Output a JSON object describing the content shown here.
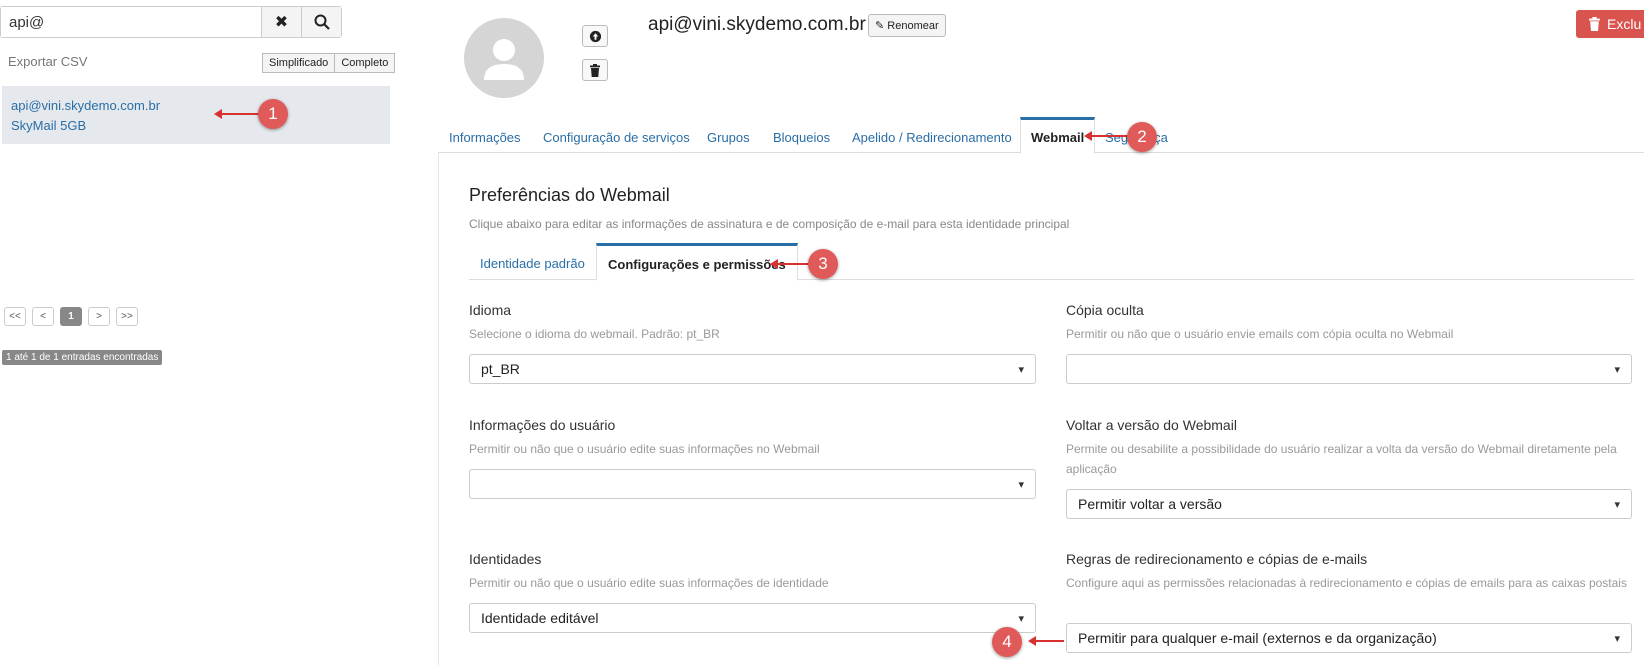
{
  "search": {
    "value": "api@"
  },
  "sidebar": {
    "export_label": "Exportar CSV",
    "view_simple": "Simplificado",
    "view_full": "Completo",
    "result": {
      "email": "api@vini.skydemo.com.br",
      "plan": "SkyMail 5GB"
    },
    "pagination": [
      "<<",
      "<",
      "1",
      ">",
      ">>"
    ],
    "entries_text": "1 até 1 de 1 entradas encontradas"
  },
  "header": {
    "title": "api@vini.skydemo.com.br",
    "rename_label": "Renomear",
    "delete_label": "Exclu"
  },
  "tabs": [
    {
      "label": "Informações"
    },
    {
      "label": "Configuração de serviços"
    },
    {
      "label": "Grupos"
    },
    {
      "label": "Bloqueios"
    },
    {
      "label": "Apelido / Redirecionamento"
    },
    {
      "label": "Webmail",
      "active": true
    },
    {
      "label": "Segurança"
    }
  ],
  "webmail": {
    "title": "Preferências do Webmail",
    "description": "Clique abaixo para editar as informações de assinatura e de composição de e-mail para esta identidade principal",
    "subtabs": [
      {
        "label": "Identidade padrão"
      },
      {
        "label": "Configurações e permissões",
        "active": true
      }
    ],
    "fields": {
      "idioma": {
        "label": "Idioma",
        "help": "Selecione o idioma do webmail. Padrão: pt_BR",
        "value": "pt_BR"
      },
      "copia_oculta": {
        "label": "Cópia oculta",
        "help": "Permitir ou não que o usuário envie emails com cópia oculta no Webmail",
        "value": ""
      },
      "info_usuario": {
        "label": "Informações do usuário",
        "help": "Permitir ou não que o usuário edite suas informações no Webmail",
        "value": ""
      },
      "voltar_versao": {
        "label": "Voltar a versão do Webmail",
        "help": "Permite ou desabilite a possibilidade do usuário realizar a volta da versão do Webmail diretamente pela aplicação",
        "value": "Permitir voltar a versão"
      },
      "identidades": {
        "label": "Identidades",
        "help": "Permitir ou não que o usuário edite suas informações de identidade",
        "value": "Identidade editável"
      },
      "regras": {
        "label": "Regras de redirecionamento e cópias de e-mails",
        "help": "Configure aqui as permissões relacionadas à redirecionamento e cópias de emails para as caixas postais",
        "value": "Permitir para qualquer e-mail (externos e da organização)"
      }
    }
  },
  "markers": [
    "1",
    "2",
    "3",
    "4"
  ],
  "colors": {
    "accent": "#2a6ea6",
    "marker": "#e05a5a",
    "danger": "#d9534f"
  }
}
